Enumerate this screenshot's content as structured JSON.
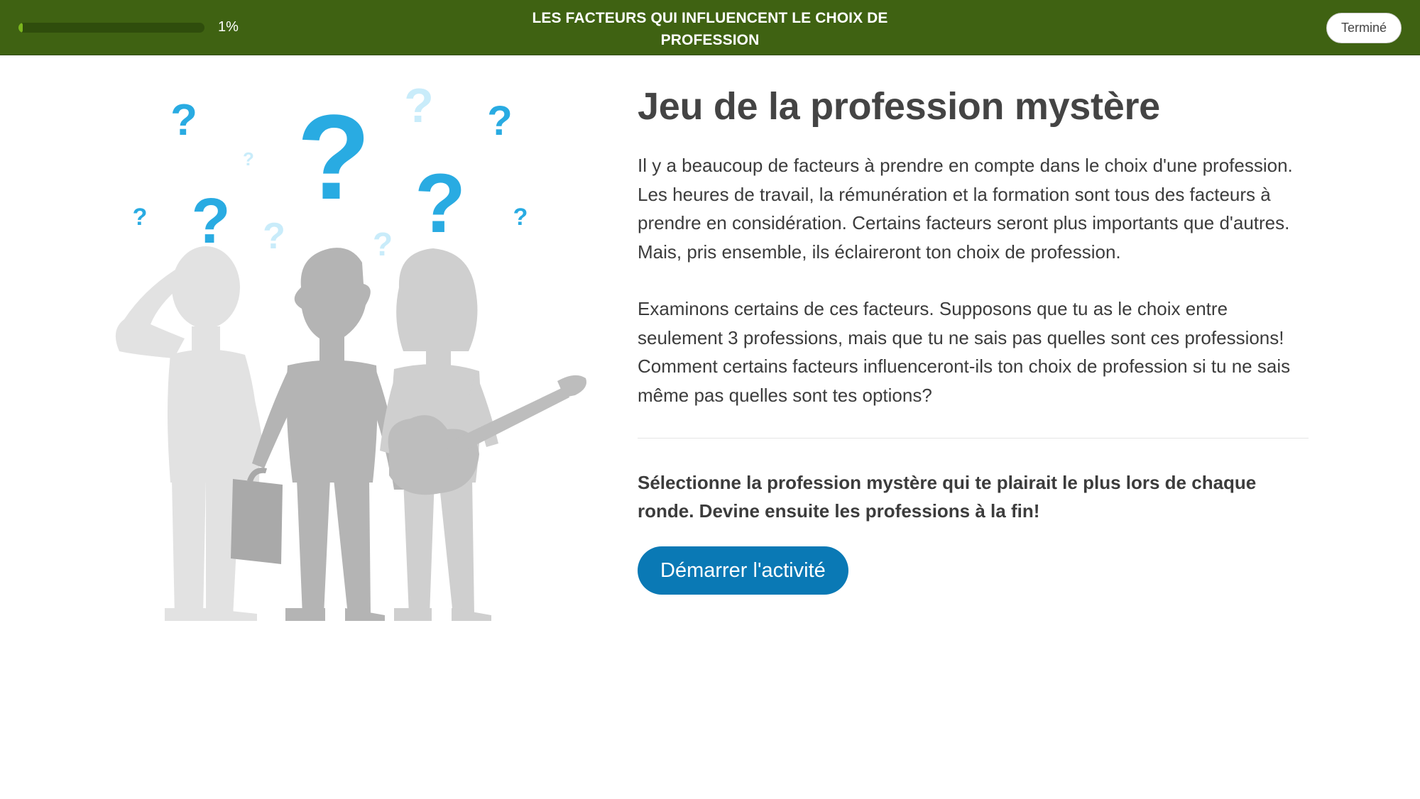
{
  "header": {
    "progress_text": "1%",
    "progress_fraction": 0.01,
    "course_title_line1": "LES FACTEURS QUI INFLUENCENT LE CHOIX DE",
    "course_title_line2": "PROFESSION",
    "done_label": "Terminé"
  },
  "activity": {
    "title": "Jeu de la profession mystère",
    "paragraph1": "Il y a beaucoup de facteurs à prendre en compte dans le choix d'une profession. Les heures de travail, la rémunération et la formation sont tous des facteurs à prendre en considération. Certains facteurs seront plus importants que d'autres. Mais, pris ensemble, ils éclaireront ton choix de profession.",
    "paragraph2": "Examinons certains de ces facteurs. Supposons que tu as le choix entre seulement 3 professions, mais que tu ne sais pas quelles sont ces professions! Comment certains facteurs influenceront-ils ton choix de profession si tu ne sais même pas quelles sont tes options?",
    "instruction": "Sélectionne la profession mystère qui te plairait le plus lors de chaque ronde. Devine ensuite les professions à la fin!",
    "start_label": "Démarrer l'activité"
  },
  "illustration": {
    "question_glyph": "?",
    "icons": [
      "question-mark-icon",
      "thinking-person-icon",
      "businessman-with-briefcase-icon",
      "guitarist-icon"
    ]
  },
  "colors": {
    "header_bg": "#3f6212",
    "progress_fill": "#7ab51d",
    "button_blue": "#0a79b5",
    "question_blue": "#29abe2",
    "question_light": "#c9ecfa"
  }
}
